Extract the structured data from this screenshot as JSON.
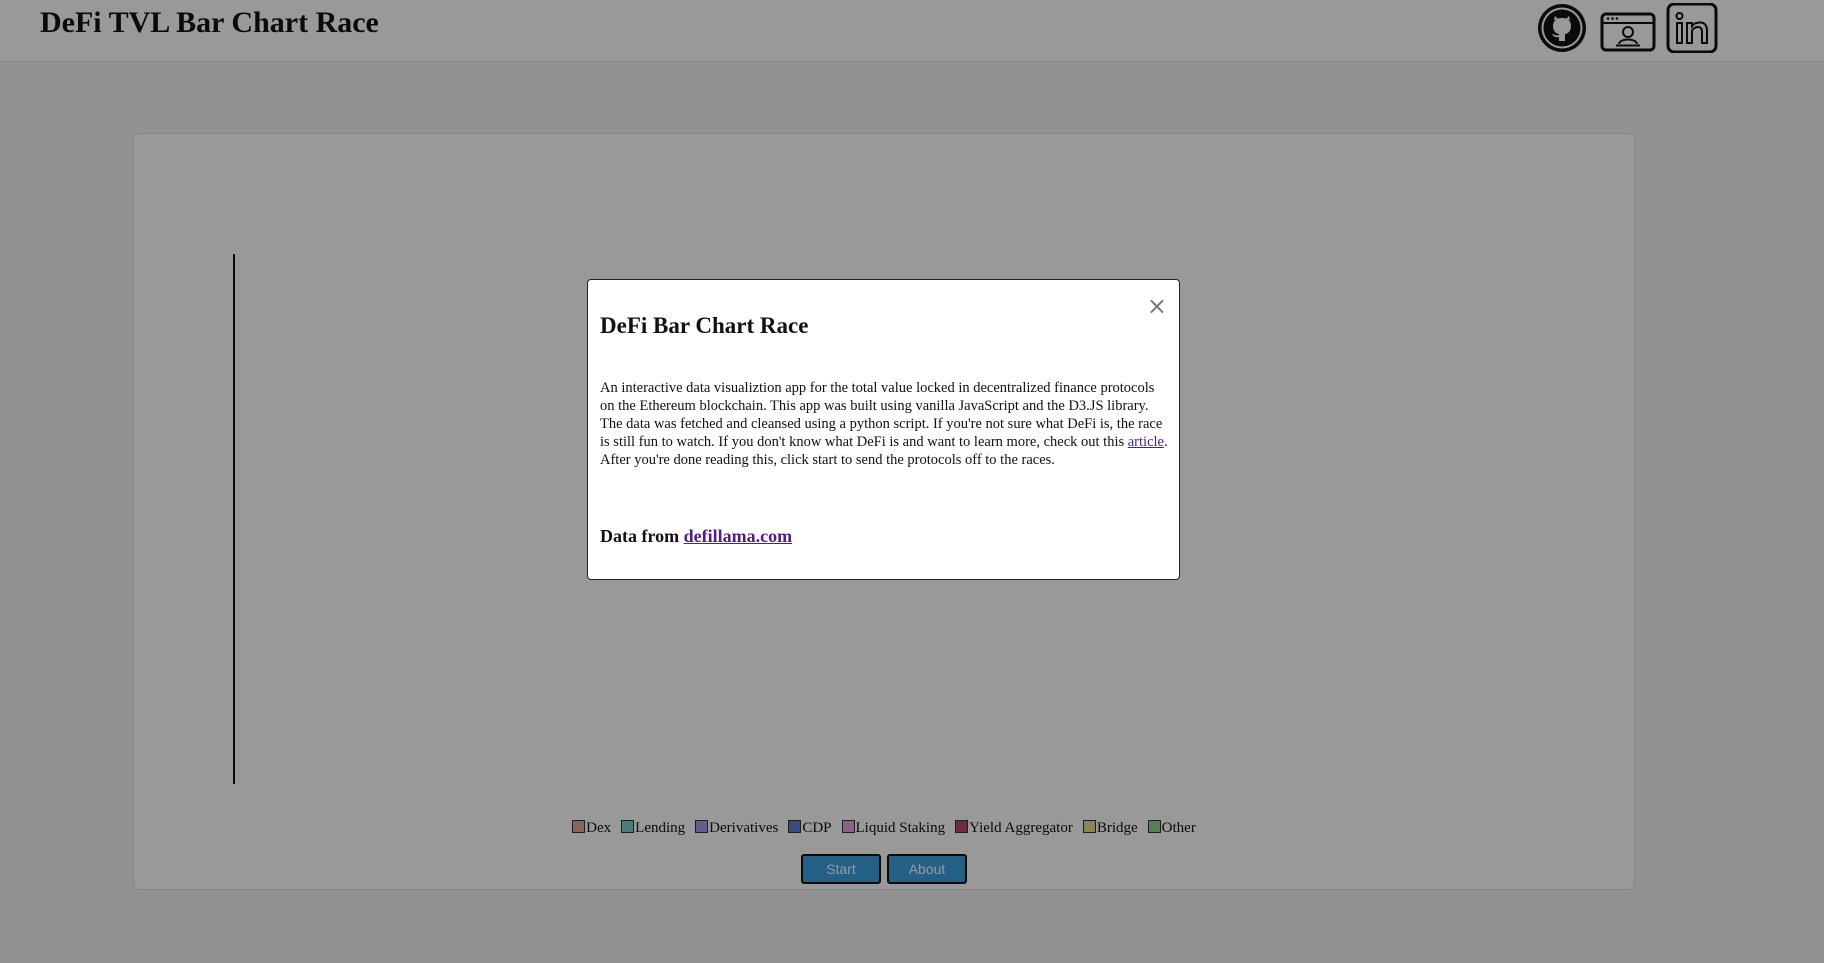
{
  "header": {
    "title": "DeFi TVL Bar Chart Race",
    "links": [
      {
        "icon": "github-icon"
      },
      {
        "icon": "portfolio-icon"
      },
      {
        "icon": "linkedin-icon"
      }
    ]
  },
  "legend": [
    {
      "label": "Dex",
      "color": "#e8a799"
    },
    {
      "label": "Lending",
      "color": "#7ed3cc"
    },
    {
      "label": "Derivatives",
      "color": "#a89ae8"
    },
    {
      "label": "CDP",
      "color": "#5b7fd6"
    },
    {
      "label": "Liquid Staking",
      "color": "#e8a2e0"
    },
    {
      "label": "Yield Aggregator",
      "color": "#b84a6c"
    },
    {
      "label": "Bridge",
      "color": "#e6e08a"
    },
    {
      "label": "Other",
      "color": "#8fd68f"
    }
  ],
  "controls": {
    "start_label": "Start",
    "about_label": "About",
    "button_color": "#3d9ee0"
  },
  "modal": {
    "title": "DeFi Bar Chart Race",
    "close_glyph": "×",
    "body_before_link": "An interactive data visualiztion app for the total value locked in decentralized finance protocols on the Ethereum blockchain. This app was built using vanilla JavaScript and the D3.JS library. The data was fetched and cleansed using a python script. If you're not sure what DeFi is, the race is still fun to watch. If you don't know what DeFi is and want to learn more, check out this ",
    "body_link": "article",
    "body_after_link": ". After you're done reading this, click start to send the protocols off to the races.",
    "source_prefix": "Data from ",
    "source_link": "defillama.com"
  }
}
